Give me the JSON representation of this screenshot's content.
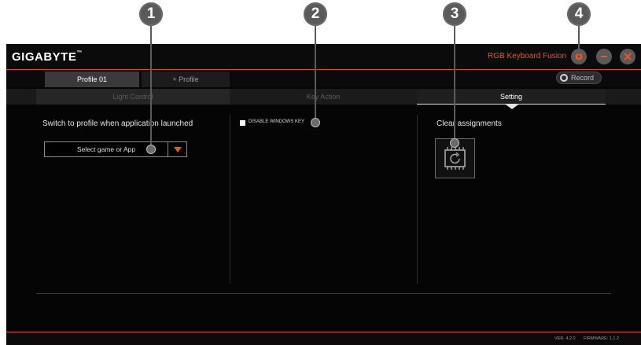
{
  "window": {
    "brand": "GIGABYTE",
    "trademark": "™",
    "product": "RGB Keyboard Fusion",
    "accent_color": "#e8571e",
    "controls": [
      "settings-icon",
      "minimize-icon",
      "close-icon"
    ]
  },
  "profiles": {
    "tabs": [
      {
        "label": "Profile 01",
        "active": true
      },
      {
        "label": "+ Profile",
        "active": false
      }
    ],
    "record_label": "Record"
  },
  "main_tabs": [
    {
      "label": "Light Control",
      "active": false
    },
    {
      "label": "Key Action",
      "active": false
    },
    {
      "label": "Setting",
      "active": true
    }
  ],
  "setting": {
    "profile_switch": {
      "heading": "Switch to profile when application launched",
      "select_value": "Select game or App"
    },
    "windows_key": {
      "label": "DISABLE WINDOWS KEY",
      "checked": false
    },
    "clear": {
      "heading": "Clear assignments",
      "icon": "clear-assignments-icon"
    }
  },
  "footer": {
    "version": "VER. 4.2.0",
    "firmware": "FIRMWARE: 1.1.2"
  },
  "callouts": [
    "1",
    "2",
    "3",
    "4"
  ]
}
